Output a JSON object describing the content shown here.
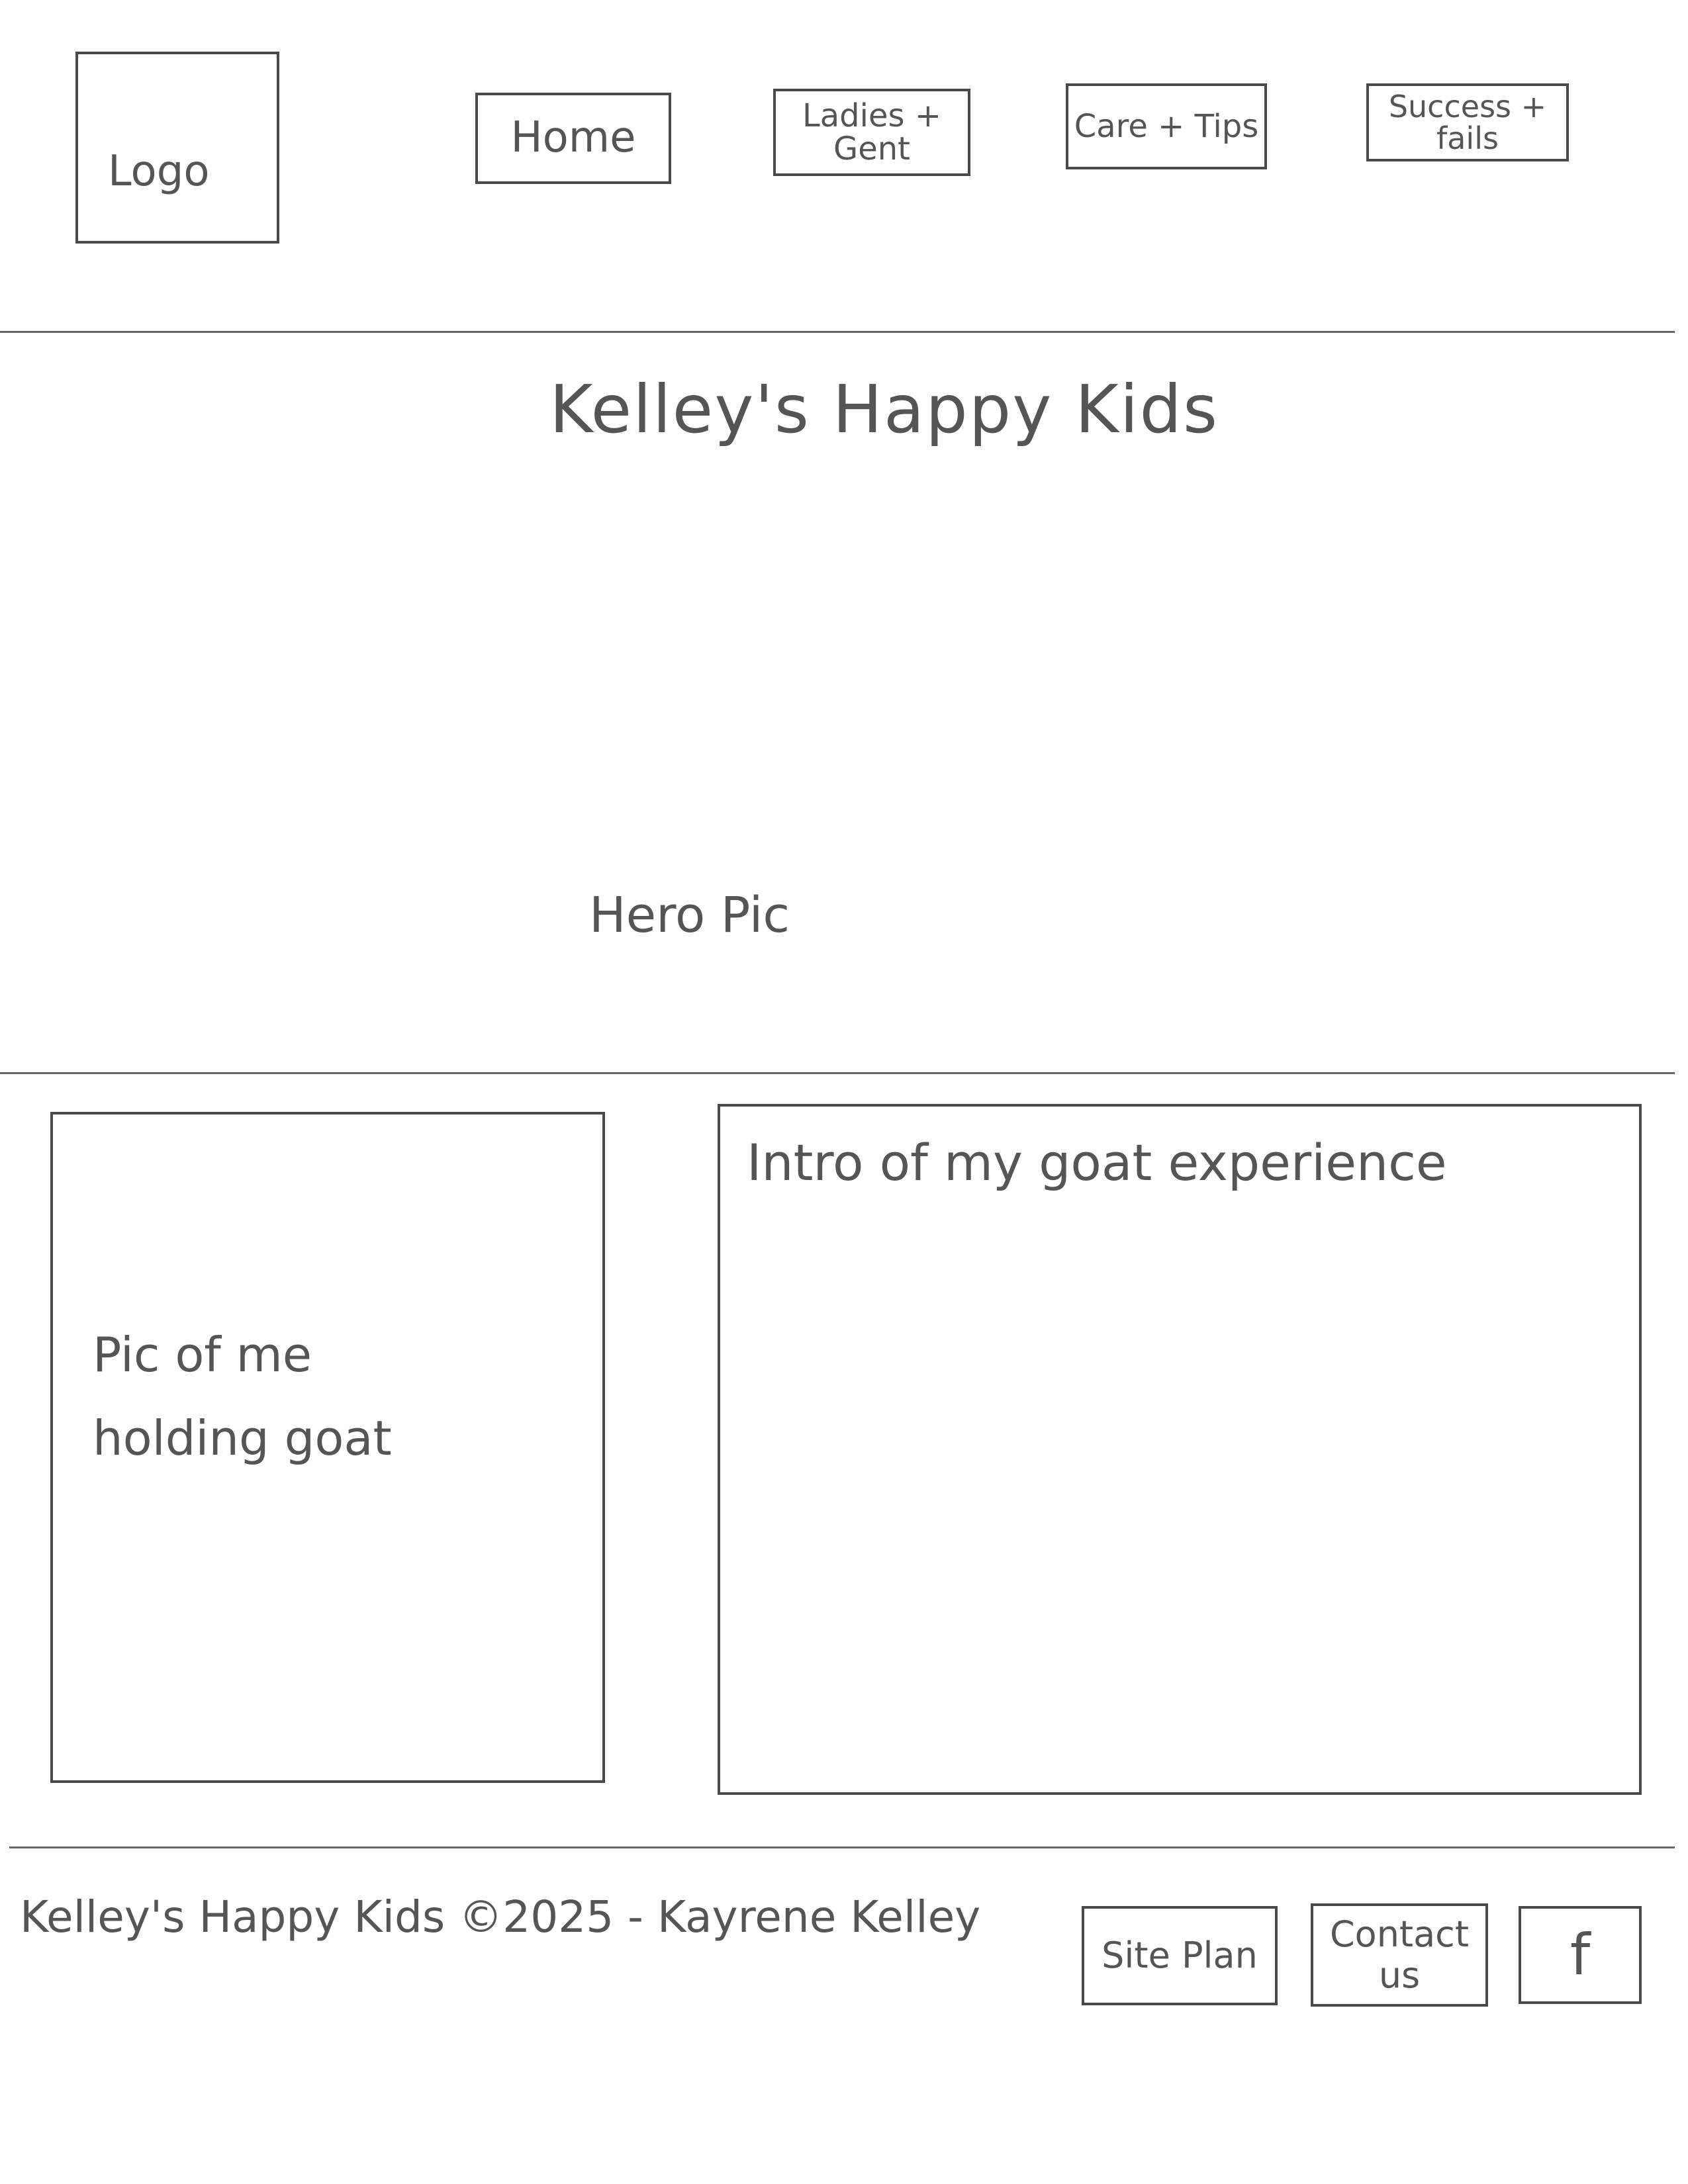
{
  "header": {
    "logo_label": "Logo",
    "nav": {
      "home": "Home",
      "ladies_gent": "Ladies + Gent",
      "care_tips": "Care + Tips",
      "success_fails": "Success + fails"
    }
  },
  "hero": {
    "title": "Kelley's Happy Kids",
    "image_label": "Hero Pic"
  },
  "content": {
    "photo_label": "Pic of me holding goat",
    "intro_label": "Intro of my goat experience"
  },
  "footer": {
    "copyright": "Kelley's Happy Kids ©2025 - Kayrene Kelley",
    "site_plan": "Site Plan",
    "contact_us": "Contact us",
    "facebook": "f"
  }
}
